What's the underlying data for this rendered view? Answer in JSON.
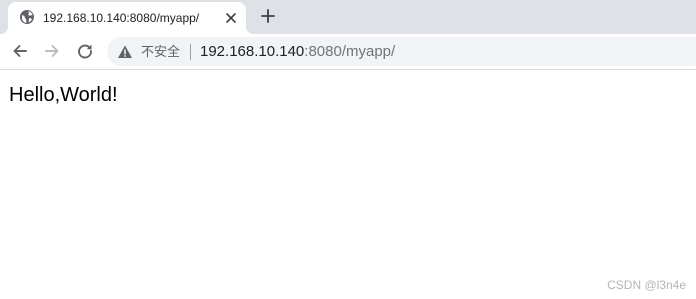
{
  "browser": {
    "tab": {
      "title": "192.168.10.140:8080/myapp/",
      "favicon": "globe-icon",
      "close_icon": "close-icon"
    },
    "new_tab_icon": "plus-icon",
    "toolbar": {
      "back_icon": "arrow-left-icon",
      "forward_icon": "arrow-right-icon",
      "reload_icon": "reload-icon"
    },
    "address_bar": {
      "security_icon": "warning-triangle-icon",
      "security_label": "不安全",
      "url_host": "192.168.10.140",
      "url_rest": ":8080/myapp/"
    }
  },
  "page": {
    "body_text": "Hello,World!"
  },
  "watermark": "CSDN @l3n4e",
  "colors": {
    "tabstrip_bg": "#dee1e6",
    "omnibox_bg": "#f1f3f4",
    "icon_color": "#5f6368",
    "text_dark": "#202124"
  }
}
